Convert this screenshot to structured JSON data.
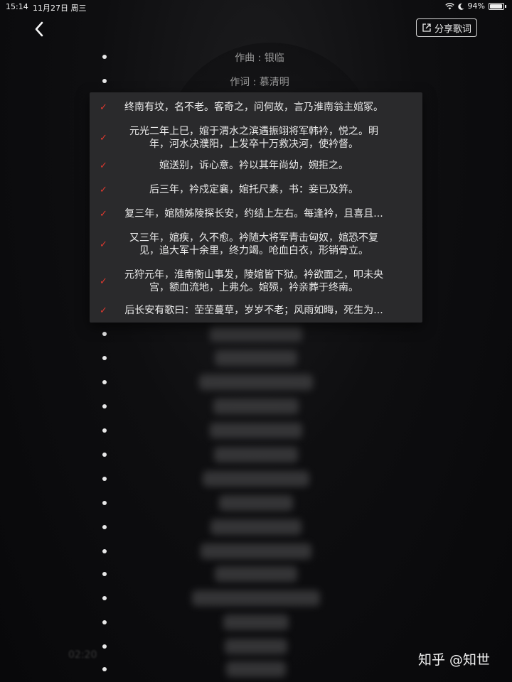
{
  "status": {
    "time": "15:14",
    "date": "11月27日 周三",
    "battery": "94%",
    "battery_level": 0.94
  },
  "header": {
    "share_label": "分享歌词"
  },
  "credits": {
    "composer": "作曲 : 银临",
    "lyricist": "作词 : 慕清明"
  },
  "menu": {
    "items": [
      {
        "lines": [
          "终南有坟，名不老。客奇之，问何故，言乃淮南翁主婠冢。"
        ],
        "checked": true
      },
      {
        "lines": [
          "元光二年上巳，婠于渭水之滨遇振翊将军韩衿，悦之。明",
          "年，河水决濮阳，上发卒十万救决河，使衿督。"
        ],
        "checked": true
      },
      {
        "lines": [
          "婠送别，诉心意。衿以其年尚幼，婉拒之。"
        ],
        "checked": true
      },
      {
        "lines": [
          "后三年，衿戍定襄，婠托尺素，书：妾已及笄。"
        ],
        "checked": true
      },
      {
        "lines": [
          "复三年，婠随姊陵探长安，约结上左右。每逢衿，且喜且..."
        ],
        "checked": true
      },
      {
        "lines": [
          "又三年，婠疾，久不愈。衿随大将军青击匈奴，婠恐不复",
          "见，追大军十余里，终力竭。呛血白衣，形销骨立。"
        ],
        "checked": true
      },
      {
        "lines": [
          "元狩元年，淮南衡山事发，陵婠皆下狱。衿欲面之，叩未央",
          "宫，额血流地，上弗允。婠殒，衿亲葬于终南。"
        ],
        "checked": true
      },
      {
        "lines": [
          "后长安有歌曰：茔茔蔓草，岁岁不老；风雨如晦，死生为..."
        ],
        "checked": true
      }
    ],
    "check_glyph": "✓"
  },
  "watermark": "知乎 @知世",
  "faint_time": "02:20"
}
